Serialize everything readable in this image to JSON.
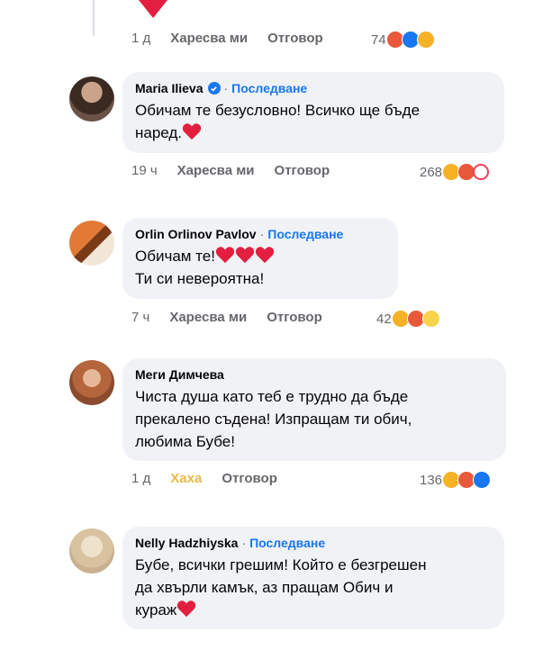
{
  "top": {
    "actions": {
      "time": "1 д",
      "like": "Харесва ми",
      "reply": "Отговор"
    },
    "reactions": {
      "count": "74",
      "icons": [
        "angry-icon",
        "like-icon",
        "haha-icon"
      ]
    }
  },
  "comments": [
    {
      "name": "Maria Ilieva",
      "verified": true,
      "follow": "Последване",
      "text": "Обичам те безусловно! Всичко ще бъде\nнаред.",
      "actions": {
        "time": "19 ч",
        "like": "Харесва ми",
        "reply": "Отговор"
      },
      "reactions": {
        "count": "268",
        "icons": [
          "haha-icon",
          "angry-icon",
          "love-icon"
        ]
      }
    },
    {
      "name": "Orlin Orlinov Pavlov",
      "follow": "Последване",
      "text_line1": "Обичам те!",
      "text_line2": "Ти си невероятна!",
      "actions": {
        "time": "7 ч",
        "like": "Харесва ми",
        "reply": "Отговор"
      },
      "reactions": {
        "count": "42",
        "icons": [
          "haha-icon",
          "angry-icon",
          "sad-icon"
        ]
      }
    },
    {
      "name": "Меги Димчева",
      "text": "Чиста душа като теб е трудно да бъде\nпрекалено съдена! Изпращам ти обич,\nлюбима Бубе!",
      "actions": {
        "time": "1 д",
        "like": "Хаха",
        "reply": "Отговор"
      },
      "reactions": {
        "count": "136",
        "icons": [
          "haha-icon",
          "angry-icon",
          "like-icon"
        ]
      }
    },
    {
      "name": "Nelly Hadzhiyska",
      "follow": "Последване",
      "text": "Бубе, всички грешим! Който е безгрешен\nда хвърли камък, аз пращам Обич и\nкураж"
    }
  ],
  "colors": {
    "accent": "#1877f2",
    "bubble": "#f0f2f5",
    "meta": "#65676b",
    "haha_label": "#e9b84a",
    "heart": "#e41e3f"
  }
}
